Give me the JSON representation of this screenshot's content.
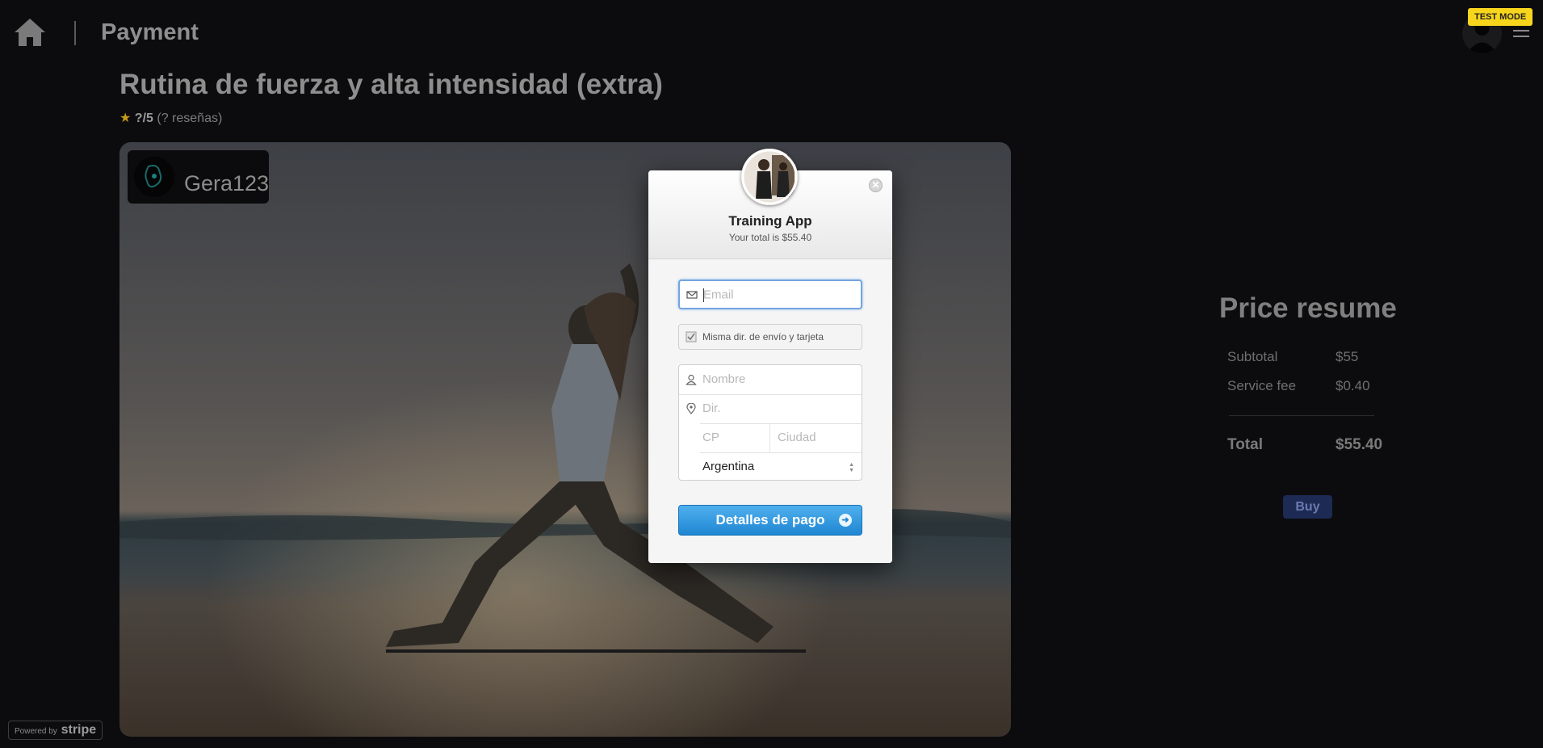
{
  "header": {
    "title": "Payment",
    "test_mode_label": "TEST MODE"
  },
  "routine": {
    "title": "Rutina de fuerza y alta intensidad (extra)",
    "rating_score": "?/5",
    "rating_reviews": "(? reseñas)",
    "creator": "Gera123"
  },
  "price": {
    "title": "Price resume",
    "subtotal_label": "Subtotal",
    "subtotal_value": "$55",
    "fee_label": "Service fee",
    "fee_value": "$0.40",
    "total_label": "Total",
    "total_value": "$55.40",
    "buy_label": "Buy"
  },
  "powered": {
    "prefix": "Powered by",
    "brand": "stripe"
  },
  "checkout": {
    "merchant": "Training App",
    "total_text": "Your total is $55.40",
    "email_placeholder": "Email",
    "same_address_label": "Misma dir. de envío y tarjeta",
    "name_placeholder": "Nombre",
    "address_placeholder": "Dir.",
    "zip_placeholder": "CP",
    "city_placeholder": "Ciudad",
    "country": "Argentina",
    "pay_label": "Detalles de pago",
    "close_symbol": "✕"
  },
  "colors": {
    "background": "#0c0c0e",
    "test_mode": "#f7d51c",
    "buy_button": "#1d2a54",
    "pay_button": "#1f86d2"
  },
  "icons": [
    "home-icon",
    "menu-icon",
    "star-icon",
    "envelope-icon",
    "checkbox-icon",
    "user-icon",
    "location-pin-icon",
    "arrow-right-icon",
    "close-icon"
  ]
}
